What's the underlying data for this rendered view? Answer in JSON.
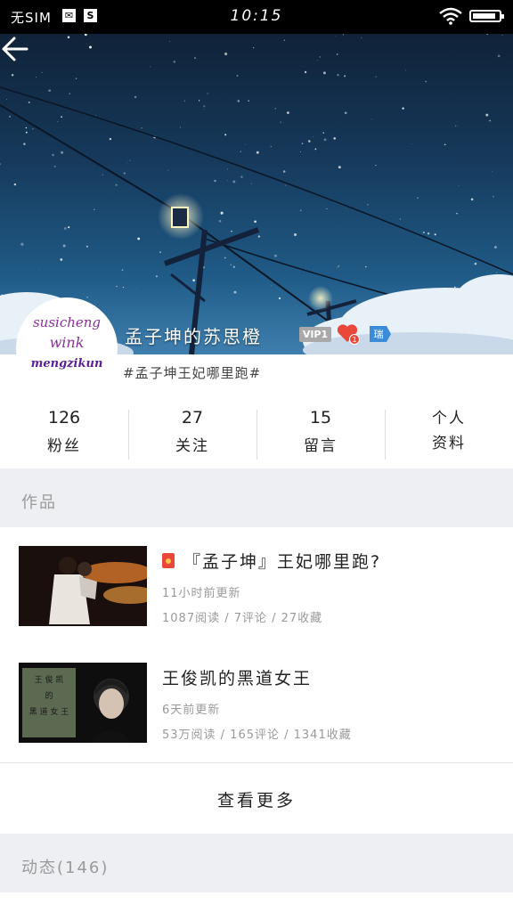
{
  "status_bar": {
    "carrier": "无SIM",
    "time": "10:15",
    "battery_level": 0.9,
    "icons": [
      "mail-icon",
      "s-app-icon",
      "wifi-icon",
      "battery-icon"
    ]
  },
  "profile": {
    "avatar_text": [
      "susicheng",
      "wink",
      "mengzikun"
    ],
    "username": "孟子坤的苏思橙",
    "vip_label": "VIP1",
    "heart_badge_count": "1",
    "fan_badge_char": "瑞",
    "signature": "#孟子坤王妃哪里跑#"
  },
  "stats": [
    {
      "value": "126",
      "label": "粉丝"
    },
    {
      "value": "27",
      "label": "关注"
    },
    {
      "value": "15",
      "label": "留言"
    },
    {
      "value": "",
      "label": "个人\n资料"
    }
  ],
  "works_section": {
    "header": "作品",
    "items": [
      {
        "title": "『孟子坤』王妃哪里跑?",
        "has_redbag": true,
        "updated": "11小时前更新",
        "meta": "1087阅读 / 7评论 / 27收藏"
      },
      {
        "title": "王俊凯的黑道女王",
        "has_redbag": false,
        "updated": "6天前更新",
        "meta": "53万阅读 / 165评论 / 1341收藏"
      }
    ],
    "more_label": "查看更多"
  },
  "activity_section": {
    "header": "动态(146)"
  },
  "colors": {
    "accent_vip": "#a9a9a9",
    "heart": "#e8473a",
    "fan_badge": "#3b8bd8",
    "section_bg": "#eeeff3"
  }
}
